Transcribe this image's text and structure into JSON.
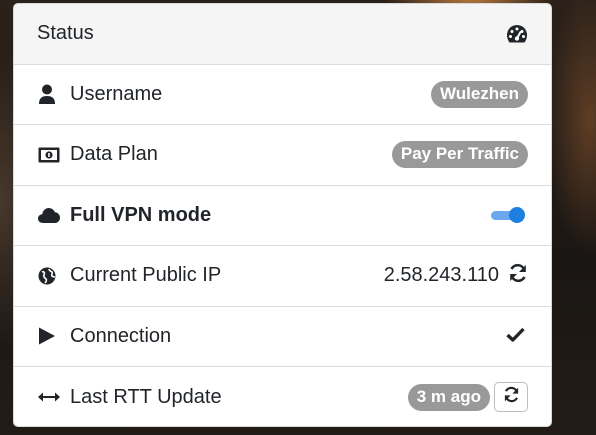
{
  "panel": {
    "title": "Status",
    "header_icon": "tachometer-icon",
    "rows": {
      "username": {
        "label": "Username",
        "icon": "user-icon",
        "value": "Wulezhen"
      },
      "data_plan": {
        "label": "Data Plan",
        "icon": "money-bill-icon",
        "value": "Pay Per Traffic"
      },
      "vpn_mode": {
        "label": "Full VPN mode",
        "icon": "cloud-icon",
        "enabled": true
      },
      "public_ip": {
        "label": "Current Public IP",
        "icon": "globe-icon",
        "value": "2.58.243.110"
      },
      "connection": {
        "label": "Connection",
        "icon": "play-icon",
        "status_icon": "check-icon"
      },
      "rtt": {
        "label": "Last RTT Update",
        "icon": "arrows-horizontal-icon",
        "value": "3 m ago"
      }
    }
  },
  "colors": {
    "badge": "#999999",
    "toggle_on": "#1e7fe0",
    "header_bg": "#f5f5f5"
  }
}
